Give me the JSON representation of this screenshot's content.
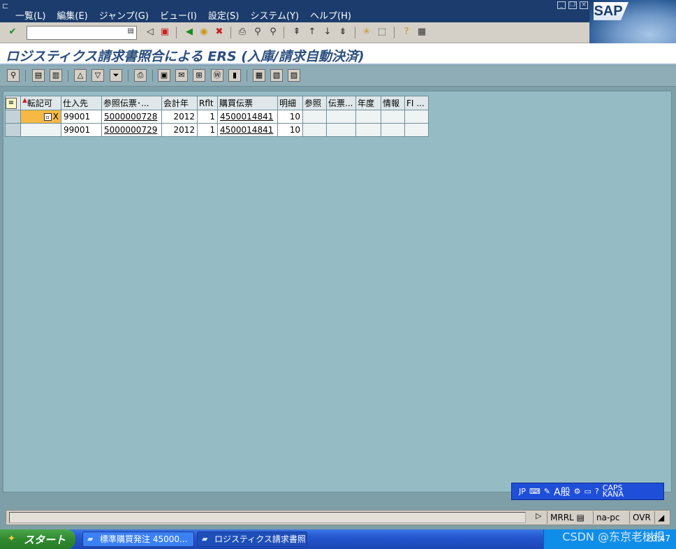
{
  "menubar": {
    "items": [
      "一覧(L)",
      "編集(E)",
      "ジャンプ(G)",
      "ビュー(I)",
      "設定(S)",
      "システム(Y)",
      "ヘルプ(H)"
    ],
    "logo": "SAP"
  },
  "toolbar": {
    "command_value": ""
  },
  "title": "ロジスティクス請求書照合による ERS (入庫/請求自動決済)",
  "grid": {
    "columns": [
      "転記可",
      "仕入先",
      "参照伝票･...",
      "会計年",
      "Rflt",
      "購買伝票",
      "明細",
      "参照",
      "伝票...",
      "年度",
      "情報",
      "FI ..."
    ],
    "rows": [
      {
        "post": "X",
        "vendor": "99001",
        "ref_doc": "5000000728",
        "year": "2012",
        "rflt": "1",
        "po": "4500014841",
        "item": "10"
      },
      {
        "post": "",
        "vendor": "99001",
        "ref_doc": "5000000729",
        "year": "2012",
        "rflt": "1",
        "po": "4500014841",
        "item": "10"
      }
    ]
  },
  "ime": {
    "lang": "JP",
    "mode": "A般",
    "caps": "CAPS",
    "kana": "KANA"
  },
  "statusbar": {
    "transaction": "MRRL",
    "server": "na-pc",
    "mode": "OVR"
  },
  "taskbar": {
    "start": "スタート",
    "tasks": [
      "標準購買発注 45000...",
      "ロジスティクス請求書照..."
    ],
    "clock": "20:47"
  },
  "watermark": "CSDN @东京老树根",
  "colors": {
    "menubar": "#1b3c6c",
    "title_text": "#2b4f7e",
    "background": "#95bcc4",
    "selected_cell": "#f7b944"
  }
}
